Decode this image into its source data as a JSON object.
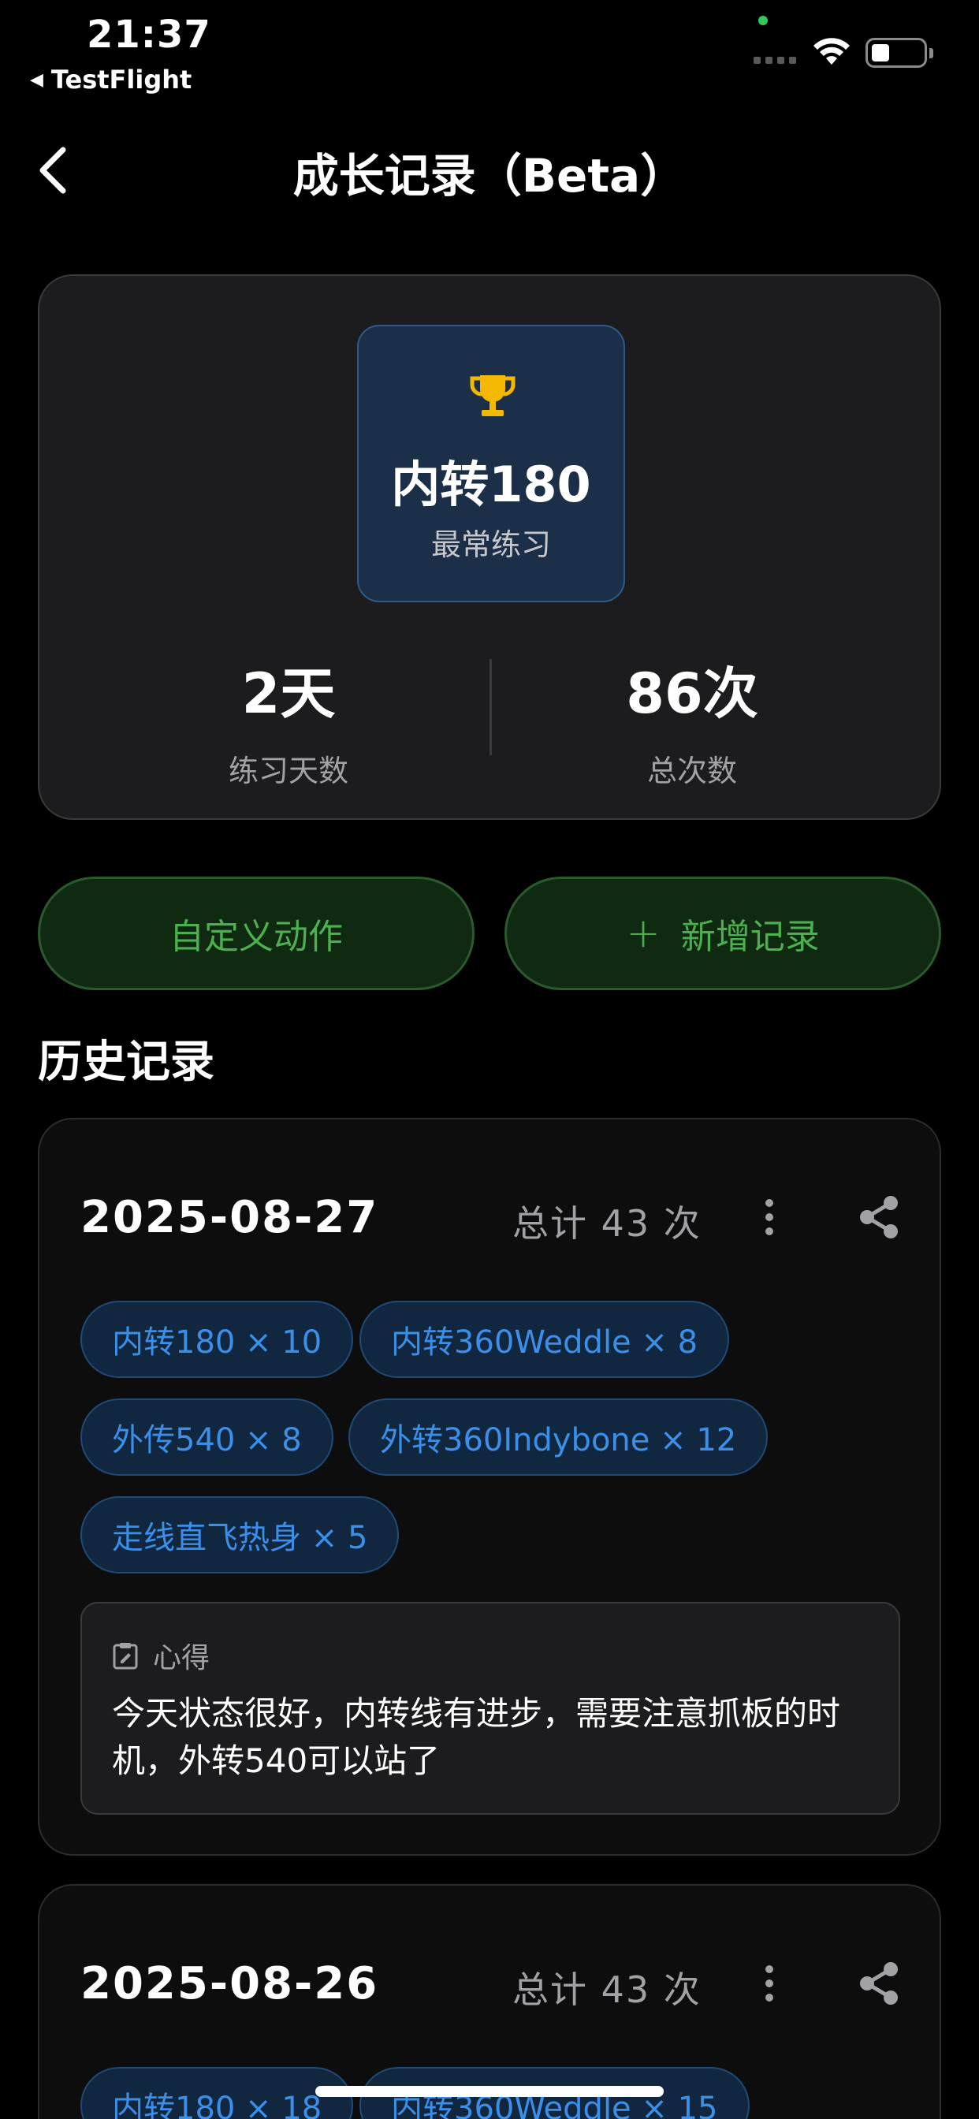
{
  "status_bar": {
    "time": "21:37",
    "back_app": "TestFlight"
  },
  "nav": {
    "title": "成长记录（Beta）"
  },
  "summary": {
    "favorite": {
      "name": "内转180",
      "label": "最常练习"
    },
    "stats": [
      {
        "value": "2天",
        "label": "练习天数"
      },
      {
        "value": "86次",
        "label": "总次数"
      }
    ]
  },
  "buttons": {
    "custom": "自定义动作",
    "add_plus": "+",
    "add": "新增记录"
  },
  "history": {
    "title": "历史记录",
    "records": [
      {
        "date": "2025-08-27",
        "total": "总计 43 次",
        "tags": [
          "内转180 × 10",
          "内转360Weddle × 8",
          "外传540 × 8",
          "外转360Indybone × 12",
          "走线直飞热身 × 5"
        ],
        "notes_label": "心得",
        "notes": "今天状态很好，内转线有进步，需要注意抓板的时机，外转540可以站了"
      },
      {
        "date": "2025-08-26",
        "total": "总计 43 次",
        "tags": [
          "内转180 × 18",
          "内转360Weddle × 15"
        ]
      }
    ]
  },
  "colors": {
    "accent_green": "#4caf50",
    "accent_blue": "#3b8fe8",
    "trophy": "#f5b800"
  }
}
